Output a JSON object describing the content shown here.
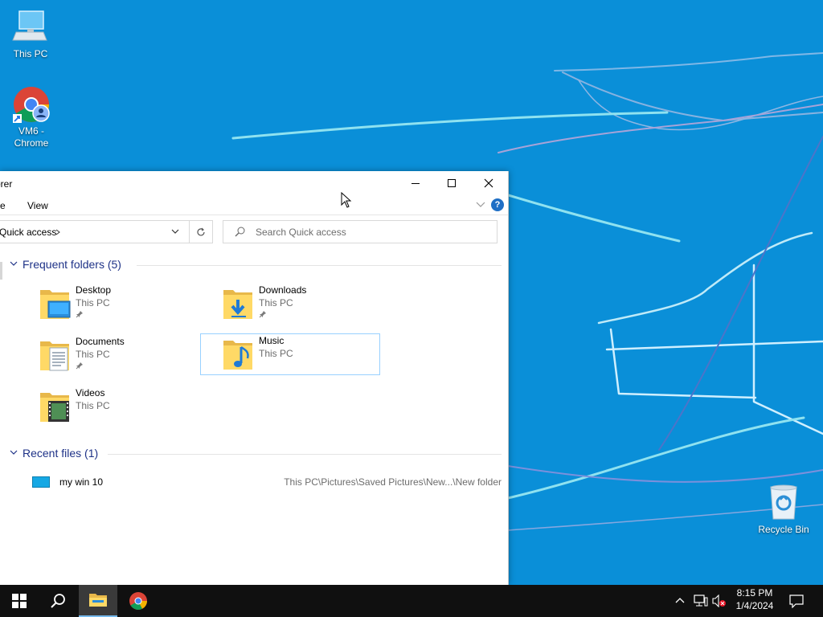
{
  "desktop": {
    "icons": [
      {
        "label": "This PC"
      },
      {
        "label": "VM6 -\nChrome"
      },
      {
        "label": "Recycle Bin"
      }
    ]
  },
  "explorer": {
    "title": "orer",
    "ribbon": {
      "tab_share": "e",
      "tab_view": "View"
    },
    "address": {
      "path": "Quick access"
    },
    "search": {
      "placeholder": "Search Quick access"
    },
    "frequent": {
      "header": "Frequent folders (5)",
      "folders": [
        {
          "name": "Desktop",
          "location": "This PC",
          "pinned": true
        },
        {
          "name": "Downloads",
          "location": "This PC",
          "pinned": true
        },
        {
          "name": "Documents",
          "location": "This PC",
          "pinned": true
        },
        {
          "name": "Music",
          "location": "This PC",
          "pinned": false
        },
        {
          "name": "Videos",
          "location": "This PC",
          "pinned": false
        }
      ]
    },
    "recent": {
      "header": "Recent files (1)",
      "files": [
        {
          "name": "my win 10",
          "path": "This PC\\Pictures\\Saved Pictures\\New...\\New folder"
        }
      ]
    }
  },
  "taskbar": {
    "time": "8:15 PM",
    "date": "1/4/2024"
  },
  "colors": {
    "desktop_bg": "#0a8fd8",
    "taskbar_bg": "#101010",
    "section_header": "#1e3287",
    "selection_border": "#99d1ff"
  }
}
